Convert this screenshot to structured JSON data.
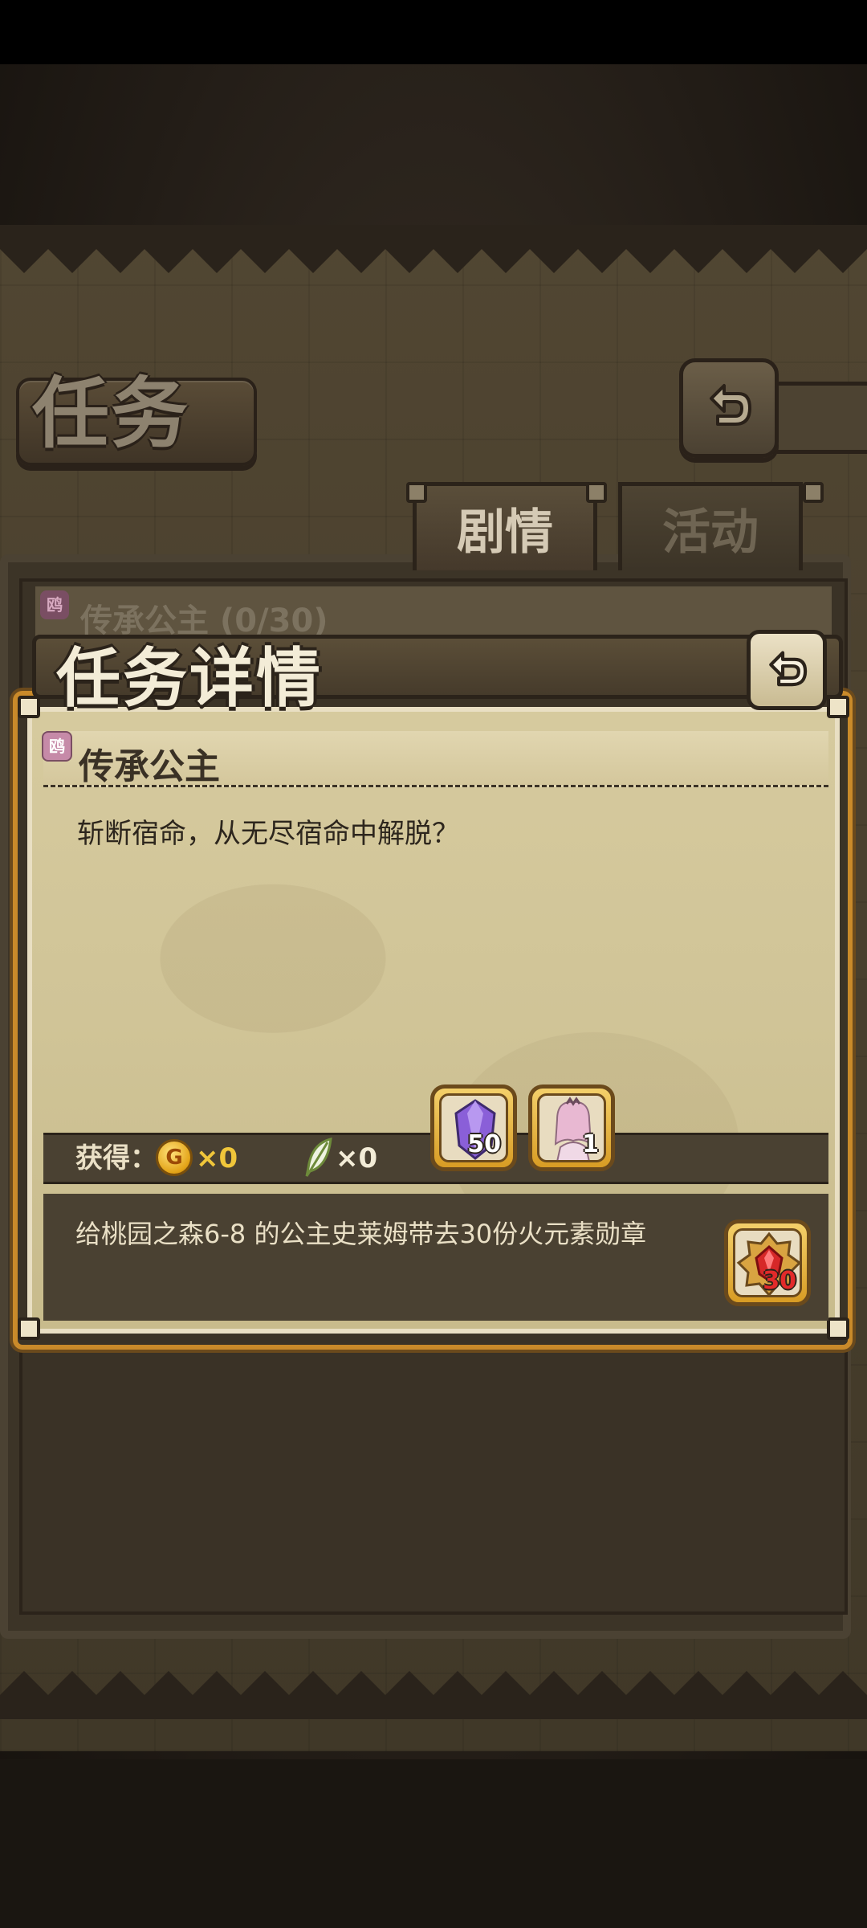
{
  "screen": {
    "title": "任务",
    "tabs": [
      {
        "label": "剧情",
        "active": true
      },
      {
        "label": "活动",
        "active": false
      }
    ],
    "list_peek": {
      "badge": "鸥",
      "text": "传承公主 (0/30)"
    }
  },
  "dialog": {
    "title": "任务详情",
    "quest": {
      "badge": "鸥",
      "name": "传承公主",
      "description": "斩断宿命，从无尽宿命中解脱？"
    },
    "rewards": {
      "label": "获得：",
      "coin_symbol": "G",
      "coin_count": "×0",
      "feather_count": "×0",
      "items": [
        {
          "icon": "purple-crystal-icon",
          "count": "50"
        },
        {
          "icon": "princess-portrait-icon",
          "count": "1"
        }
      ]
    },
    "objective": {
      "text": "给桃园之森6-8 的公主史莱姆带去30份火元素勋章",
      "item_icon": "fire-medal-icon",
      "item_count": "30"
    }
  },
  "colors": {
    "accent_gold": "#d89c24",
    "paper": "#d0c497",
    "dark_brown": "#2b231a",
    "coin_text": "#f0c63a",
    "medal_count": "#e22a2a"
  }
}
